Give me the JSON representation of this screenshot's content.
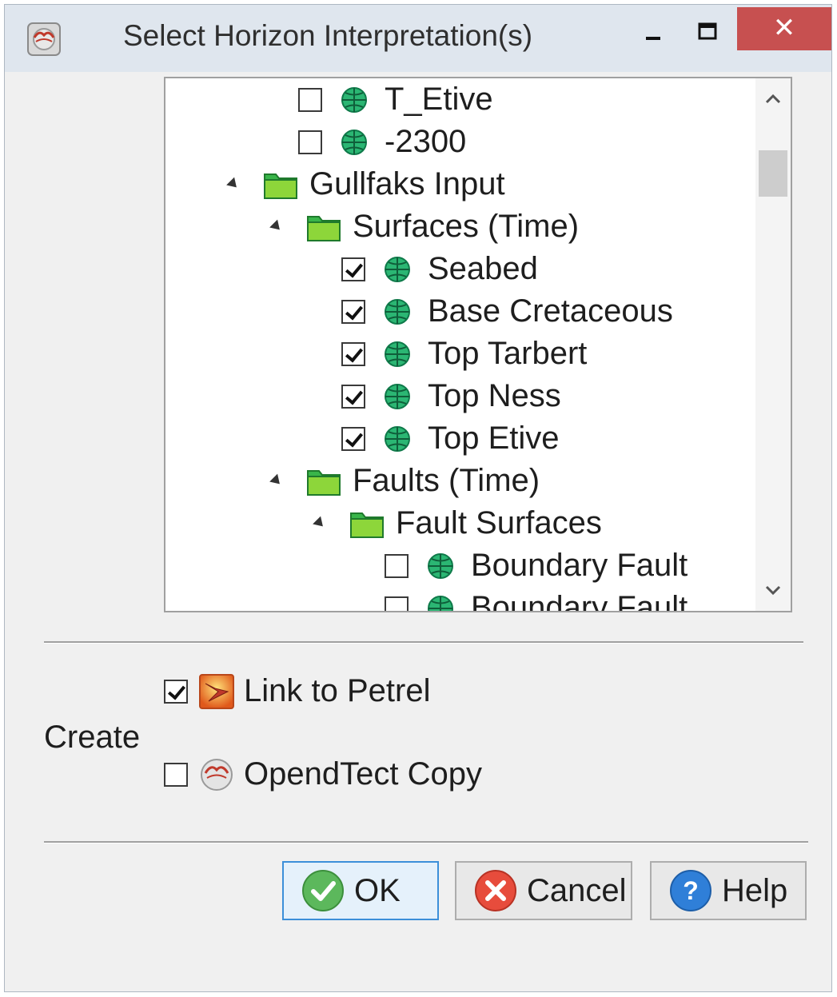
{
  "window": {
    "title": "Select Horizon Interpretation(s)",
    "close_glyph": "✕"
  },
  "tree": {
    "items": [
      {
        "label": "T_Etive",
        "kind": "surface",
        "checked": false
      },
      {
        "label": "-2300",
        "kind": "surface",
        "checked": false
      },
      {
        "label": "Gullfaks Input",
        "kind": "folder",
        "expanded": true
      },
      {
        "label": "Surfaces (Time)",
        "kind": "folder",
        "expanded": true
      },
      {
        "label": "Seabed",
        "kind": "surface",
        "checked": true
      },
      {
        "label": "Base Cretaceous",
        "kind": "surface",
        "checked": true
      },
      {
        "label": "Top Tarbert",
        "kind": "surface",
        "checked": true
      },
      {
        "label": "Top Ness",
        "kind": "surface",
        "checked": true
      },
      {
        "label": "Top Etive",
        "kind": "surface",
        "checked": true
      },
      {
        "label": "Faults (Time)",
        "kind": "folder",
        "expanded": true
      },
      {
        "label": "Fault Surfaces",
        "kind": "folder",
        "expanded": true
      },
      {
        "label": "Boundary Fault",
        "kind": "surface",
        "checked": false
      },
      {
        "label": "Boundary Fault",
        "kind": "surface",
        "checked": false
      }
    ]
  },
  "create": {
    "label": "Create",
    "link_to_petrel": {
      "label": "Link to Petrel",
      "checked": true
    },
    "opendtect_copy": {
      "label": "OpendTect Copy",
      "checked": false
    }
  },
  "buttons": {
    "ok": "OK",
    "cancel": "Cancel",
    "help": "Help"
  }
}
